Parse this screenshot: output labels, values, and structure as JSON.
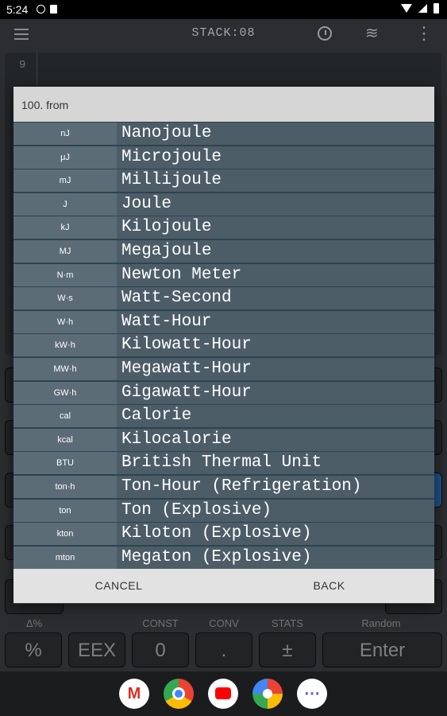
{
  "status_bar": {
    "time": "5:24"
  },
  "app_bar": {
    "title": "STACK:08"
  },
  "display": {
    "stack_level": "9"
  },
  "keypad": {
    "labels": [
      "Δ%",
      "CONST",
      "CONV",
      "STATS",
      "Random"
    ],
    "bottom_keys": [
      "%",
      "EEX",
      "0",
      ".",
      "±",
      "Enter"
    ]
  },
  "dialog": {
    "title": "100. from",
    "units": [
      {
        "symbol": "nJ",
        "name": "Nanojoule"
      },
      {
        "symbol": "μJ",
        "name": "Microjoule"
      },
      {
        "symbol": "mJ",
        "name": "Millijoule"
      },
      {
        "symbol": "J",
        "name": "Joule"
      },
      {
        "symbol": "kJ",
        "name": "Kilojoule"
      },
      {
        "symbol": "MJ",
        "name": "Megajoule"
      },
      {
        "symbol": "N·m",
        "name": "Newton Meter"
      },
      {
        "symbol": "W·s",
        "name": "Watt-Second"
      },
      {
        "symbol": "W·h",
        "name": "Watt-Hour"
      },
      {
        "symbol": "kW·h",
        "name": "Kilowatt-Hour"
      },
      {
        "symbol": "MW·h",
        "name": "Megawatt-Hour"
      },
      {
        "symbol": "GW·h",
        "name": "Gigawatt-Hour"
      },
      {
        "symbol": "cal",
        "name": "Calorie"
      },
      {
        "symbol": "kcal",
        "name": "Kilocalorie"
      },
      {
        "symbol": "BTU",
        "name": "British Thermal Unit"
      },
      {
        "symbol": "ton·h",
        "name": "Ton-Hour (Refrigeration)"
      },
      {
        "symbol": "ton",
        "name": "Ton (Explosive)"
      },
      {
        "symbol": "kton",
        "name": "Kiloton (Explosive)"
      },
      {
        "symbol": "mton",
        "name": "Megaton (Explosive)"
      }
    ],
    "cancel_label": "CANCEL",
    "back_label": "BACK"
  },
  "dock": {
    "apps": [
      "gmail-icon",
      "chrome-icon",
      "youtube-icon",
      "photos-icon",
      "app-drawer-icon"
    ]
  }
}
